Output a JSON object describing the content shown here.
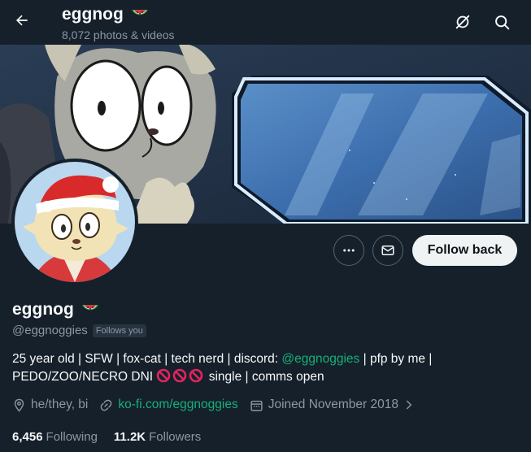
{
  "header": {
    "name": "eggnog",
    "name_emoji": "watermelon-icon",
    "media_count": "8,072 photos & videos"
  },
  "actions": {
    "follow_label": "Follow back"
  },
  "profile": {
    "display_name": "eggnog",
    "handle": "@eggnoggies",
    "follows_you": "Follows you",
    "bio": {
      "part1": "25 year old | SFW | fox-cat | tech nerd | discord: ",
      "discord": "@eggnoggies",
      "part2": " | pfp by me |",
      "part3": "PEDO/ZOO/NECRO DNI ",
      "part4": " single | comms open"
    },
    "pronouns": "he/they, bi",
    "website": "ko-fi.com/eggnoggies",
    "joined": "Joined November 2018",
    "following_count": "6,456",
    "following_label": "Following",
    "followers_count": "11.2K",
    "followers_label": "Followers"
  },
  "colors": {
    "background": "#15202b",
    "text": "#f7f9f9",
    "secondary": "#8b98a5",
    "link_blue": "#1d9bf0",
    "link_green": "#17b079",
    "button_bg": "#eff3f4"
  }
}
